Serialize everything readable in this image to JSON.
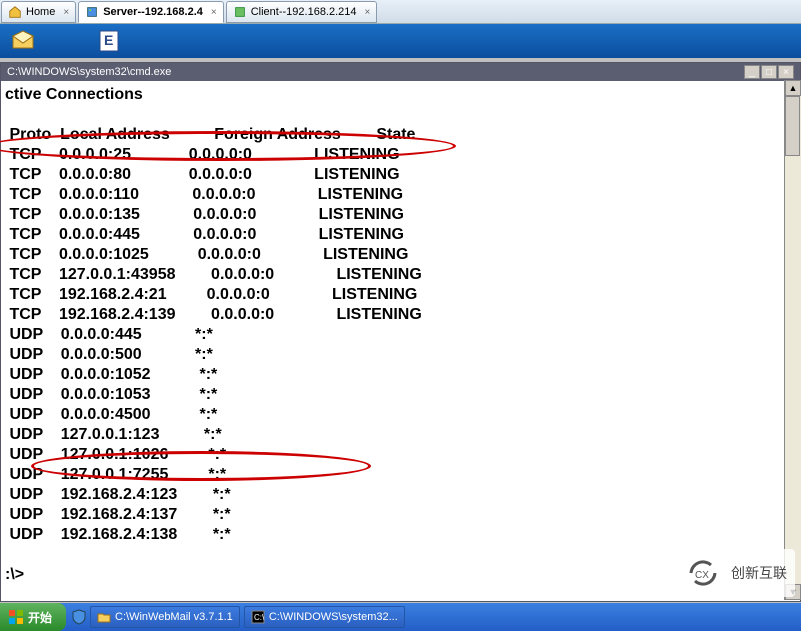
{
  "tabs": [
    {
      "icon": "home",
      "label": "Home"
    },
    {
      "icon": "server",
      "label": "Server--192.168.2.4"
    },
    {
      "icon": "client",
      "label": "Client--192.168.2.214"
    }
  ],
  "activeTab": 1,
  "windowTitle": "C:\\WINDOWS\\system32\\cmd.exe",
  "header": {
    "title": "ctive Connections"
  },
  "cols": {
    "proto": "Proto",
    "local": "Local Address",
    "foreign": "Foreign Address",
    "state": "State"
  },
  "rows": [
    {
      "p": "TCP",
      "l": "0.0.0.0:25",
      "f": "0.0.0.0:0",
      "s": "LISTENING"
    },
    {
      "p": "TCP",
      "l": "0.0.0.0:80",
      "f": "0.0.0.0:0",
      "s": "LISTENING"
    },
    {
      "p": "TCP",
      "l": "0.0.0.0:110",
      "f": "0.0.0.0:0",
      "s": "LISTENING"
    },
    {
      "p": "TCP",
      "l": "0.0.0.0:135",
      "f": "0.0.0.0:0",
      "s": "LISTENING"
    },
    {
      "p": "TCP",
      "l": "0.0.0.0:445",
      "f": "0.0.0.0:0",
      "s": "LISTENING"
    },
    {
      "p": "TCP",
      "l": "0.0.0.0:1025",
      "f": "0.0.0.0:0",
      "s": "LISTENING"
    },
    {
      "p": "TCP",
      "l": "127.0.0.1:43958",
      "f": "0.0.0.0:0",
      "s": "LISTENING"
    },
    {
      "p": "TCP",
      "l": "192.168.2.4:21",
      "f": "0.0.0.0:0",
      "s": "LISTENING"
    },
    {
      "p": "TCP",
      "l": "192.168.2.4:139",
      "f": "0.0.0.0:0",
      "s": "LISTENING"
    },
    {
      "p": "UDP",
      "l": "0.0.0.0:445",
      "f": "*:*",
      "s": ""
    },
    {
      "p": "UDP",
      "l": "0.0.0.0:500",
      "f": "*:*",
      "s": ""
    },
    {
      "p": "UDP",
      "l": "0.0.0.0:1052",
      "f": "*:*",
      "s": ""
    },
    {
      "p": "UDP",
      "l": "0.0.0.0:1053",
      "f": "*:*",
      "s": ""
    },
    {
      "p": "UDP",
      "l": "0.0.0.0:4500",
      "f": "*:*",
      "s": ""
    },
    {
      "p": "UDP",
      "l": "127.0.0.1:123",
      "f": "*:*",
      "s": ""
    },
    {
      "p": "UDP",
      "l": "127.0.0.1:1026",
      "f": "*:*",
      "s": ""
    },
    {
      "p": "UDP",
      "l": "127.0.0.1:7255",
      "f": "*:*",
      "s": ""
    },
    {
      "p": "UDP",
      "l": "192.168.2.4:123",
      "f": "*:*",
      "s": ""
    },
    {
      "p": "UDP",
      "l": "192.168.2.4:137",
      "f": "*:*",
      "s": ""
    },
    {
      "p": "UDP",
      "l": "192.168.2.4:138",
      "f": "*:*",
      "s": ""
    }
  ],
  "prompt": ":\\>",
  "startLabel": "开始",
  "taskItems": [
    {
      "icon": "folder",
      "label": "C:\\WinWebMail v3.7.1.1"
    },
    {
      "icon": "cmd",
      "label": "C:\\WINDOWS\\system32..."
    }
  ],
  "logoText": "创新互联"
}
